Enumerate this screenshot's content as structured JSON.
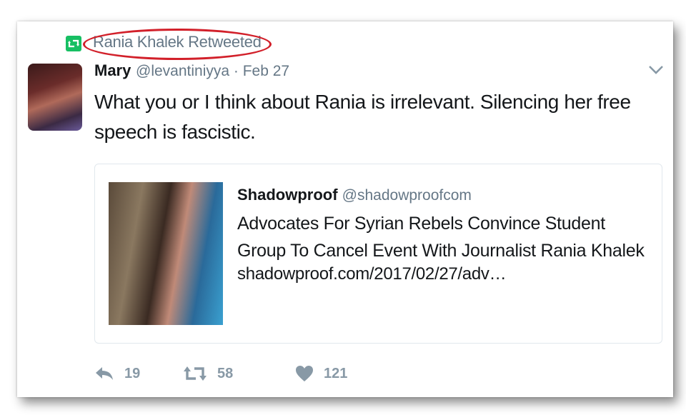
{
  "retweet": {
    "icon": "retweet-badge-icon",
    "text": "Rania Khalek Retweeted",
    "highlight_color": "#d2202a"
  },
  "tweet": {
    "name": "Mary",
    "handle_time": "@levantiniyya · Feb 27",
    "text": "What you or I think about Rania is irrelevant. Silencing her free speech is fascistic.",
    "menu_icon": "chevron-down-icon"
  },
  "link_card": {
    "site_name": "Shadowproof",
    "site_handle": "@shadowproofcom",
    "headline": "Advocates For Syrian Rebels Convince Student Group To Cancel Event With Journalist Rania Khalek",
    "url": "shadowproof.com/2017/02/27/adv…"
  },
  "actions": {
    "reply": {
      "icon": "reply-icon",
      "count": "19"
    },
    "retweet": {
      "icon": "retweet-icon",
      "count": "58"
    },
    "like": {
      "icon": "heart-icon",
      "count": "121"
    }
  },
  "colors": {
    "text": "#14171a",
    "muted": "#657786",
    "action": "#8899a6",
    "retweet_green": "#17bf63",
    "border": "#e1e8ed"
  }
}
